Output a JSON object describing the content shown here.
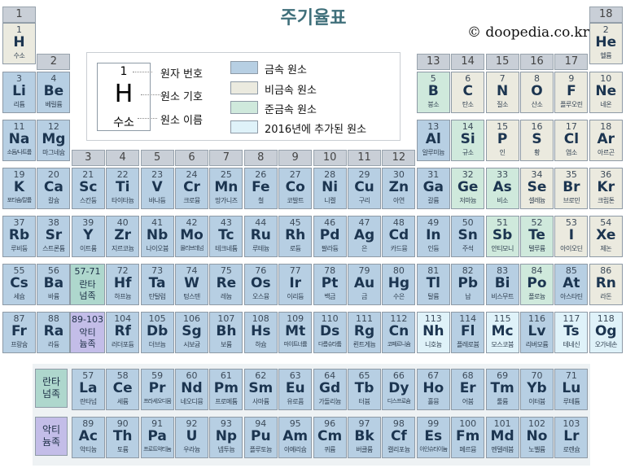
{
  "title": "주기율표",
  "copyright": "© doopedia.co.kr",
  "groups": [
    "1",
    "2",
    "3",
    "4",
    "5",
    "6",
    "7",
    "8",
    "9",
    "10",
    "11",
    "12",
    "13",
    "14",
    "15",
    "16",
    "17",
    "18"
  ],
  "legend": {
    "sample_number": "1",
    "sample_symbol": "H",
    "sample_name": "수소",
    "label_number": "원자 번호",
    "label_symbol": "원소 기호",
    "label_name": "원소 이름",
    "types": [
      {
        "label": "금속 원소",
        "color": "#b7cfe3"
      },
      {
        "label": "비금속 원소",
        "color": "#ebeadf"
      },
      {
        "label": "준금속 원소",
        "color": "#cfe9dc"
      },
      {
        "label": "2016년에 추가된 원소",
        "color": "#dff2f9"
      }
    ]
  },
  "lanthanide_placeholder": {
    "number": "57-71",
    "label": "란타넘족"
  },
  "actinide_placeholder": {
    "number": "89-103",
    "label": "악티늄족"
  },
  "lanthanide_row_label": "란타넘족",
  "actinide_row_label": "악티늄족",
  "elements": [
    {
      "n": "1",
      "s": "H",
      "k": "수소",
      "row": 1,
      "col": 1,
      "t": "nonmetal"
    },
    {
      "n": "2",
      "s": "He",
      "k": "헬륨",
      "row": 1,
      "col": 18,
      "t": "nonmetal"
    },
    {
      "n": "3",
      "s": "Li",
      "k": "리튬",
      "row": 2,
      "col": 1,
      "t": "metal"
    },
    {
      "n": "4",
      "s": "Be",
      "k": "베릴륨",
      "row": 2,
      "col": 2,
      "t": "metal"
    },
    {
      "n": "5",
      "s": "B",
      "k": "붕소",
      "row": 2,
      "col": 13,
      "t": "metalloid"
    },
    {
      "n": "6",
      "s": "C",
      "k": "탄소",
      "row": 2,
      "col": 14,
      "t": "nonmetal"
    },
    {
      "n": "7",
      "s": "N",
      "k": "질소",
      "row": 2,
      "col": 15,
      "t": "nonmetal"
    },
    {
      "n": "8",
      "s": "O",
      "k": "산소",
      "row": 2,
      "col": 16,
      "t": "nonmetal"
    },
    {
      "n": "9",
      "s": "F",
      "k": "플루오린",
      "row": 2,
      "col": 17,
      "t": "nonmetal"
    },
    {
      "n": "10",
      "s": "Ne",
      "k": "네온",
      "row": 2,
      "col": 18,
      "t": "nonmetal"
    },
    {
      "n": "11",
      "s": "Na",
      "k": "소듐/나트륨",
      "row": 3,
      "col": 1,
      "t": "metal"
    },
    {
      "n": "12",
      "s": "Mg",
      "k": "마그네슘",
      "row": 3,
      "col": 2,
      "t": "metal"
    },
    {
      "n": "13",
      "s": "Al",
      "k": "알루미늄",
      "row": 3,
      "col": 13,
      "t": "metal"
    },
    {
      "n": "14",
      "s": "Si",
      "k": "규소",
      "row": 3,
      "col": 14,
      "t": "metalloid"
    },
    {
      "n": "15",
      "s": "P",
      "k": "인",
      "row": 3,
      "col": 15,
      "t": "nonmetal"
    },
    {
      "n": "16",
      "s": "S",
      "k": "황",
      "row": 3,
      "col": 16,
      "t": "nonmetal"
    },
    {
      "n": "17",
      "s": "Cl",
      "k": "염소",
      "row": 3,
      "col": 17,
      "t": "nonmetal"
    },
    {
      "n": "18",
      "s": "Ar",
      "k": "아르곤",
      "row": 3,
      "col": 18,
      "t": "nonmetal"
    },
    {
      "n": "19",
      "s": "K",
      "k": "포타슘/칼륨",
      "row": 4,
      "col": 1,
      "t": "metal"
    },
    {
      "n": "20",
      "s": "Ca",
      "k": "칼슘",
      "row": 4,
      "col": 2,
      "t": "metal"
    },
    {
      "n": "21",
      "s": "Sc",
      "k": "스칸듐",
      "row": 4,
      "col": 3,
      "t": "metal"
    },
    {
      "n": "22",
      "s": "Ti",
      "k": "타이타늄",
      "row": 4,
      "col": 4,
      "t": "metal"
    },
    {
      "n": "23",
      "s": "V",
      "k": "바나듐",
      "row": 4,
      "col": 5,
      "t": "metal"
    },
    {
      "n": "24",
      "s": "Cr",
      "k": "크로뮴",
      "row": 4,
      "col": 6,
      "t": "metal"
    },
    {
      "n": "25",
      "s": "Mn",
      "k": "망가니즈",
      "row": 4,
      "col": 7,
      "t": "metal"
    },
    {
      "n": "26",
      "s": "Fe",
      "k": "철",
      "row": 4,
      "col": 8,
      "t": "metal"
    },
    {
      "n": "27",
      "s": "Co",
      "k": "코발트",
      "row": 4,
      "col": 9,
      "t": "metal"
    },
    {
      "n": "28",
      "s": "Ni",
      "k": "니켈",
      "row": 4,
      "col": 10,
      "t": "metal"
    },
    {
      "n": "29",
      "s": "Cu",
      "k": "구리",
      "row": 4,
      "col": 11,
      "t": "metal"
    },
    {
      "n": "30",
      "s": "Zn",
      "k": "아연",
      "row": 4,
      "col": 12,
      "t": "metal"
    },
    {
      "n": "31",
      "s": "Ga",
      "k": "갈륨",
      "row": 4,
      "col": 13,
      "t": "metal"
    },
    {
      "n": "32",
      "s": "Ge",
      "k": "저마늄",
      "row": 4,
      "col": 14,
      "t": "metalloid"
    },
    {
      "n": "33",
      "s": "As",
      "k": "비소",
      "row": 4,
      "col": 15,
      "t": "metalloid"
    },
    {
      "n": "34",
      "s": "Se",
      "k": "셀레늄",
      "row": 4,
      "col": 16,
      "t": "nonmetal"
    },
    {
      "n": "35",
      "s": "Br",
      "k": "브로민",
      "row": 4,
      "col": 17,
      "t": "nonmetal"
    },
    {
      "n": "36",
      "s": "Kr",
      "k": "크립톤",
      "row": 4,
      "col": 18,
      "t": "nonmetal"
    },
    {
      "n": "37",
      "s": "Rb",
      "k": "루비듐",
      "row": 5,
      "col": 1,
      "t": "metal"
    },
    {
      "n": "38",
      "s": "Sr",
      "k": "스트론튬",
      "row": 5,
      "col": 2,
      "t": "metal"
    },
    {
      "n": "39",
      "s": "Y",
      "k": "이트륨",
      "row": 5,
      "col": 3,
      "t": "metal"
    },
    {
      "n": "40",
      "s": "Zr",
      "k": "지르코늄",
      "row": 5,
      "col": 4,
      "t": "metal"
    },
    {
      "n": "41",
      "s": "Nb",
      "k": "나이오븀",
      "row": 5,
      "col": 5,
      "t": "metal"
    },
    {
      "n": "42",
      "s": "Mo",
      "k": "몰리브데넘",
      "row": 5,
      "col": 6,
      "t": "metal"
    },
    {
      "n": "43",
      "s": "Tc",
      "k": "테크네튬",
      "row": 5,
      "col": 7,
      "t": "metal"
    },
    {
      "n": "44",
      "s": "Ru",
      "k": "루테늄",
      "row": 5,
      "col": 8,
      "t": "metal"
    },
    {
      "n": "45",
      "s": "Rh",
      "k": "로듐",
      "row": 5,
      "col": 9,
      "t": "metal"
    },
    {
      "n": "46",
      "s": "Pd",
      "k": "팔라듐",
      "row": 5,
      "col": 10,
      "t": "metal"
    },
    {
      "n": "47",
      "s": "Ag",
      "k": "은",
      "row": 5,
      "col": 11,
      "t": "metal"
    },
    {
      "n": "48",
      "s": "Cd",
      "k": "카드뮴",
      "row": 5,
      "col": 12,
      "t": "metal"
    },
    {
      "n": "49",
      "s": "In",
      "k": "인듐",
      "row": 5,
      "col": 13,
      "t": "metal"
    },
    {
      "n": "50",
      "s": "Sn",
      "k": "주석",
      "row": 5,
      "col": 14,
      "t": "metal"
    },
    {
      "n": "51",
      "s": "Sb",
      "k": "안티모니",
      "row": 5,
      "col": 15,
      "t": "metalloid"
    },
    {
      "n": "52",
      "s": "Te",
      "k": "텔루륨",
      "row": 5,
      "col": 16,
      "t": "metalloid"
    },
    {
      "n": "53",
      "s": "I",
      "k": "아이오딘",
      "row": 5,
      "col": 17,
      "t": "nonmetal"
    },
    {
      "n": "54",
      "s": "Xe",
      "k": "제논",
      "row": 5,
      "col": 18,
      "t": "nonmetal"
    },
    {
      "n": "55",
      "s": "Cs",
      "k": "세슘",
      "row": 6,
      "col": 1,
      "t": "metal"
    },
    {
      "n": "56",
      "s": "Ba",
      "k": "바륨",
      "row": 6,
      "col": 2,
      "t": "metal"
    },
    {
      "n": "72",
      "s": "Hf",
      "k": "하프늄",
      "row": 6,
      "col": 4,
      "t": "metal"
    },
    {
      "n": "73",
      "s": "Ta",
      "k": "탄탈럼",
      "row": 6,
      "col": 5,
      "t": "metal"
    },
    {
      "n": "74",
      "s": "W",
      "k": "텅스텐",
      "row": 6,
      "col": 6,
      "t": "metal"
    },
    {
      "n": "75",
      "s": "Re",
      "k": "레늄",
      "row": 6,
      "col": 7,
      "t": "metal"
    },
    {
      "n": "76",
      "s": "Os",
      "k": "오스뮴",
      "row": 6,
      "col": 8,
      "t": "metal"
    },
    {
      "n": "77",
      "s": "Ir",
      "k": "이리듐",
      "row": 6,
      "col": 9,
      "t": "metal"
    },
    {
      "n": "78",
      "s": "Pt",
      "k": "백금",
      "row": 6,
      "col": 10,
      "t": "metal"
    },
    {
      "n": "79",
      "s": "Au",
      "k": "금",
      "row": 6,
      "col": 11,
      "t": "metal"
    },
    {
      "n": "80",
      "s": "Hg",
      "k": "수은",
      "row": 6,
      "col": 12,
      "t": "metal"
    },
    {
      "n": "81",
      "s": "Tl",
      "k": "탈륨",
      "row": 6,
      "col": 13,
      "t": "metal"
    },
    {
      "n": "82",
      "s": "Pb",
      "k": "납",
      "row": 6,
      "col": 14,
      "t": "metal"
    },
    {
      "n": "83",
      "s": "Bi",
      "k": "비스무트",
      "row": 6,
      "col": 15,
      "t": "metal"
    },
    {
      "n": "84",
      "s": "Po",
      "k": "폴로늄",
      "row": 6,
      "col": 16,
      "t": "metalloid"
    },
    {
      "n": "85",
      "s": "At",
      "k": "아스타틴",
      "row": 6,
      "col": 17,
      "t": "metal"
    },
    {
      "n": "86",
      "s": "Rn",
      "k": "라돈",
      "row": 6,
      "col": 18,
      "t": "nonmetal"
    },
    {
      "n": "87",
      "s": "Fr",
      "k": "프랑슘",
      "row": 7,
      "col": 1,
      "t": "metal"
    },
    {
      "n": "88",
      "s": "Ra",
      "k": "라듐",
      "row": 7,
      "col": 2,
      "t": "metal"
    },
    {
      "n": "104",
      "s": "Rf",
      "k": "러더포듐",
      "row": 7,
      "col": 4,
      "t": "metal"
    },
    {
      "n": "105",
      "s": "Db",
      "k": "더브늄",
      "row": 7,
      "col": 5,
      "t": "metal"
    },
    {
      "n": "106",
      "s": "Sg",
      "k": "시보귬",
      "row": 7,
      "col": 6,
      "t": "metal"
    },
    {
      "n": "107",
      "s": "Bh",
      "k": "보륨",
      "row": 7,
      "col": 7,
      "t": "metal"
    },
    {
      "n": "108",
      "s": "Hs",
      "k": "하슘",
      "row": 7,
      "col": 8,
      "t": "metal"
    },
    {
      "n": "109",
      "s": "Mt",
      "k": "마이트너륨",
      "row": 7,
      "col": 9,
      "t": "metal"
    },
    {
      "n": "110",
      "s": "Ds",
      "k": "다름슈타튬",
      "row": 7,
      "col": 10,
      "t": "metal"
    },
    {
      "n": "111",
      "s": "Rg",
      "k": "뢴트게늄",
      "row": 7,
      "col": 11,
      "t": "metal"
    },
    {
      "n": "112",
      "s": "Cn",
      "k": "코페르니슘",
      "row": 7,
      "col": 12,
      "t": "metal"
    },
    {
      "n": "113",
      "s": "Nh",
      "k": "니호늄",
      "row": 7,
      "col": 13,
      "t": "new"
    },
    {
      "n": "114",
      "s": "Fl",
      "k": "플레로븀",
      "row": 7,
      "col": 14,
      "t": "metal"
    },
    {
      "n": "115",
      "s": "Mc",
      "k": "모스코븀",
      "row": 7,
      "col": 15,
      "t": "new"
    },
    {
      "n": "116",
      "s": "Lv",
      "k": "리버모륨",
      "row": 7,
      "col": 16,
      "t": "metal"
    },
    {
      "n": "117",
      "s": "Ts",
      "k": "테네신",
      "row": 7,
      "col": 17,
      "t": "new"
    },
    {
      "n": "118",
      "s": "Og",
      "k": "오가네손",
      "row": 7,
      "col": 18,
      "t": "new"
    },
    {
      "n": "57",
      "s": "La",
      "k": "란타넘",
      "row": 9,
      "col": 3,
      "t": "metal"
    },
    {
      "n": "58",
      "s": "Ce",
      "k": "세륨",
      "row": 9,
      "col": 4,
      "t": "metal"
    },
    {
      "n": "59",
      "s": "Pr",
      "k": "프라세오디뮴",
      "row": 9,
      "col": 5,
      "t": "metal"
    },
    {
      "n": "60",
      "s": "Nd",
      "k": "네오디뮴",
      "row": 9,
      "col": 6,
      "t": "metal"
    },
    {
      "n": "61",
      "s": "Pm",
      "k": "프로메튬",
      "row": 9,
      "col": 7,
      "t": "metal"
    },
    {
      "n": "62",
      "s": "Sm",
      "k": "사마륨",
      "row": 9,
      "col": 8,
      "t": "metal"
    },
    {
      "n": "63",
      "s": "Eu",
      "k": "유로퓸",
      "row": 9,
      "col": 9,
      "t": "metal"
    },
    {
      "n": "64",
      "s": "Gd",
      "k": "가돌리늄",
      "row": 9,
      "col": 10,
      "t": "metal"
    },
    {
      "n": "65",
      "s": "Tb",
      "k": "터븀",
      "row": 9,
      "col": 11,
      "t": "metal"
    },
    {
      "n": "66",
      "s": "Dy",
      "k": "디스프로슘",
      "row": 9,
      "col": 12,
      "t": "metal"
    },
    {
      "n": "67",
      "s": "Ho",
      "k": "홀뮴",
      "row": 9,
      "col": 13,
      "t": "metal"
    },
    {
      "n": "68",
      "s": "Er",
      "k": "어븀",
      "row": 9,
      "col": 14,
      "t": "metal"
    },
    {
      "n": "69",
      "s": "Tm",
      "k": "툴륨",
      "row": 9,
      "col": 15,
      "t": "metal"
    },
    {
      "n": "70",
      "s": "Yb",
      "k": "이터븀",
      "row": 9,
      "col": 16,
      "t": "metal"
    },
    {
      "n": "71",
      "s": "Lu",
      "k": "루테튬",
      "row": 9,
      "col": 17,
      "t": "metal"
    },
    {
      "n": "89",
      "s": "Ac",
      "k": "악티늄",
      "row": 10,
      "col": 3,
      "t": "metal"
    },
    {
      "n": "90",
      "s": "Th",
      "k": "토륨",
      "row": 10,
      "col": 4,
      "t": "metal"
    },
    {
      "n": "91",
      "s": "Pa",
      "k": "프로트악티늄",
      "row": 10,
      "col": 5,
      "t": "metal"
    },
    {
      "n": "92",
      "s": "U",
      "k": "우라늄",
      "row": 10,
      "col": 6,
      "t": "metal"
    },
    {
      "n": "93",
      "s": "Np",
      "k": "넵투늄",
      "row": 10,
      "col": 7,
      "t": "metal"
    },
    {
      "n": "94",
      "s": "Pu",
      "k": "플루토늄",
      "row": 10,
      "col": 8,
      "t": "metal"
    },
    {
      "n": "95",
      "s": "Am",
      "k": "아메리슘",
      "row": 10,
      "col": 9,
      "t": "metal"
    },
    {
      "n": "96",
      "s": "Cm",
      "k": "퀴륨",
      "row": 10,
      "col": 10,
      "t": "metal"
    },
    {
      "n": "97",
      "s": "Bk",
      "k": "버클륨",
      "row": 10,
      "col": 11,
      "t": "metal"
    },
    {
      "n": "98",
      "s": "Cf",
      "k": "캘리포늄",
      "row": 10,
      "col": 12,
      "t": "metal"
    },
    {
      "n": "99",
      "s": "Es",
      "k": "아인슈타이늄",
      "row": 10,
      "col": 13,
      "t": "metal"
    },
    {
      "n": "100",
      "s": "Fm",
      "k": "페르뮴",
      "row": 10,
      "col": 14,
      "t": "metal"
    },
    {
      "n": "101",
      "s": "Md",
      "k": "멘델레븀",
      "row": 10,
      "col": 15,
      "t": "metal"
    },
    {
      "n": "102",
      "s": "No",
      "k": "노벨륨",
      "row": 10,
      "col": 16,
      "t": "metal"
    },
    {
      "n": "103",
      "s": "Lr",
      "k": "로렌슘",
      "row": 10,
      "col": 17,
      "t": "metal"
    }
  ]
}
